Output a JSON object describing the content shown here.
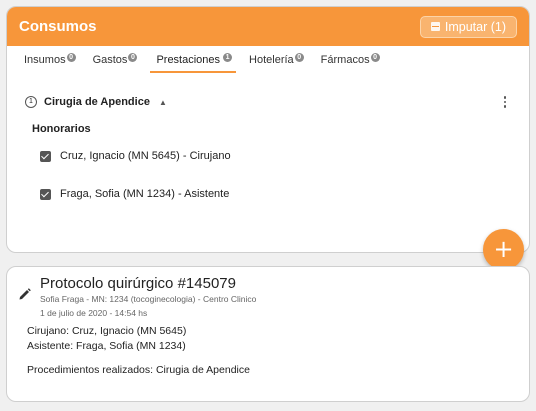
{
  "consumos": {
    "title": "Consumos",
    "imputar_label": "Imputar (1)",
    "tabs": [
      {
        "label": "Insumos",
        "count": "0",
        "active": false
      },
      {
        "label": "Gastos",
        "count": "0",
        "active": false
      },
      {
        "label": "Prestaciones",
        "count": "1",
        "active": true
      },
      {
        "label": "Hotelería",
        "count": "0",
        "active": false
      },
      {
        "label": "Fármacos",
        "count": "0",
        "active": false
      }
    ],
    "section": {
      "number": "1",
      "title": "Cirugia de Apendice",
      "chevron": "▲"
    },
    "group_label": "Honorarios",
    "items": [
      {
        "label": "Cruz, Ignacio (MN 5645) - Cirujano",
        "checked": true
      },
      {
        "label": "Fraga, Sofia (MN 1234) - Asistente",
        "checked": true
      }
    ],
    "fab_label": "+"
  },
  "protocolo": {
    "title": "Protocolo quirúrgico #145079",
    "subtitle": "Sofia Fraga - MN: 1234 (tocoginecologia) - Centro Clinico",
    "date": "1 de julio de 2020 - 14:54 hs",
    "cirujano": "Cirujano: Cruz, Ignacio (MN 5645)",
    "asistente": "Asistente: Fraga, Sofia (MN 1234)",
    "procedimientos": "Procedimientos realizados: Cirugia de Apendice"
  },
  "colors": {
    "accent": "#f7963a"
  },
  "icons": [
    "imputar-icon",
    "chevron-up-icon",
    "kebab-menu-icon",
    "checkbox-checked-icon",
    "plus-icon",
    "pencil-icon"
  ]
}
